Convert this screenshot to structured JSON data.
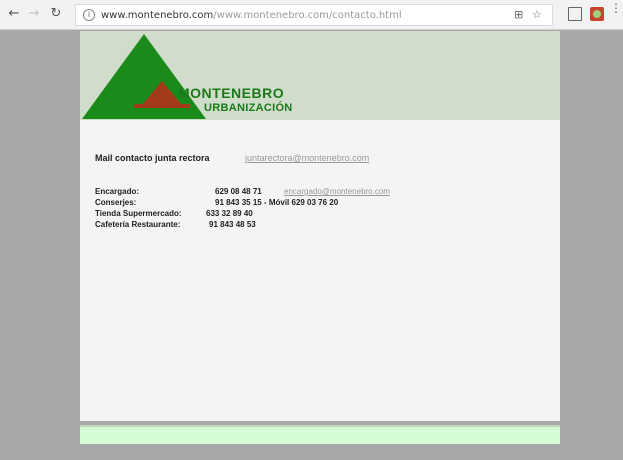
{
  "browser": {
    "back_icon": "arrow-left-icon",
    "forward_icon": "arrow-right-icon",
    "reload_icon": "reload-icon",
    "url_host": "www.montenebro.com",
    "url_path": "/www.montenebro.com/contacto.html",
    "actions": [
      "translate-icon",
      "star-icon",
      "cast-icon",
      "extension-icon",
      "menu-icon"
    ]
  },
  "header": {
    "brand_line1": "MONTENEBRO",
    "brand_line2": "URBANIZACIÓN"
  },
  "mail": {
    "label": "Mail contacto junta rectora",
    "email": "juntarectora@montenebro.com"
  },
  "contacts": [
    {
      "label": "Encargado:",
      "value": "629 08 48 71",
      "email": "encargado@montenebro.com"
    },
    {
      "label": "Conserjes:",
      "value": "91 843 35 15 - Móvil 629 03 76 20"
    },
    {
      "label": "Tienda Supermercado:",
      "value": "633 32 89 40"
    },
    {
      "label": "Cafetería Restaurante:",
      "value": "91 843 48 53"
    }
  ],
  "colors": {
    "header_bg": "#d0ddca",
    "tree_green": "#1a8a1a",
    "tree_red": "#a33a1a",
    "footer_bg": "#d6fcd6"
  }
}
